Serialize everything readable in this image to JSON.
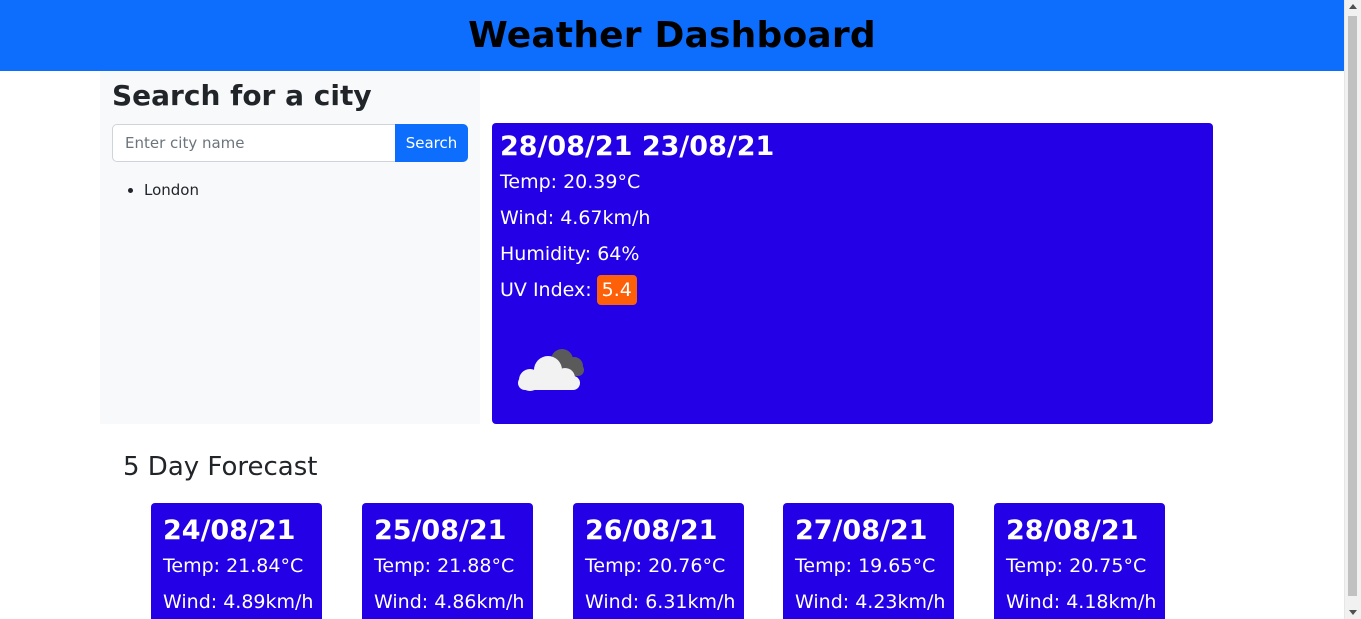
{
  "header": {
    "title": "Weather Dashboard"
  },
  "sidebar": {
    "title": "Search for a city",
    "search": {
      "placeholder": "Enter city name",
      "value": "",
      "button_label": "Search"
    },
    "history": [
      "London"
    ]
  },
  "current": {
    "date": "28/08/21 23/08/21",
    "temp": "Temp: 20.39°C",
    "wind": "Wind: 4.67km/h",
    "humidity": "Humidity: 64%",
    "uv_label": "UV Index:",
    "uv_value": "5.4",
    "uv_color": "#fd6009",
    "icon": "cloudy-icon"
  },
  "forecast": {
    "title": "5 Day Forecast",
    "days": [
      {
        "date": "24/08/21",
        "temp": "Temp: 21.84°C",
        "wind": "Wind: 4.89km/h"
      },
      {
        "date": "25/08/21",
        "temp": "Temp: 21.88°C",
        "wind": "Wind: 4.86km/h"
      },
      {
        "date": "26/08/21",
        "temp": "Temp: 20.76°C",
        "wind": "Wind: 6.31km/h"
      },
      {
        "date": "27/08/21",
        "temp": "Temp: 19.65°C",
        "wind": "Wind: 4.23km/h"
      },
      {
        "date": "28/08/21",
        "temp": "Temp: 20.75°C",
        "wind": "Wind: 4.18km/h"
      }
    ]
  },
  "colors": {
    "header": "#0d6efd",
    "card": "#2300e6",
    "button": "#0d6efd"
  }
}
